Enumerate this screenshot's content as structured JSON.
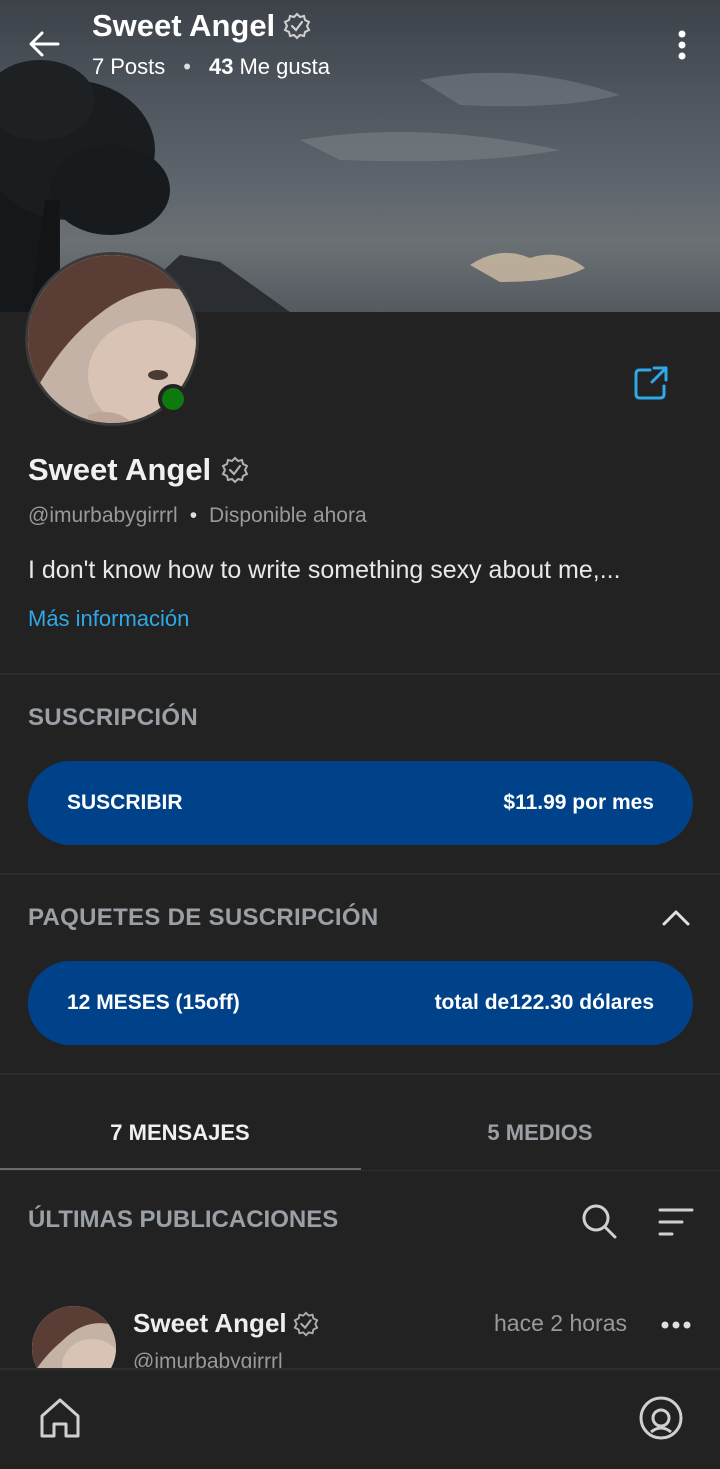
{
  "header": {
    "title": "Sweet Angel",
    "posts_count": "7",
    "posts_label": "Posts",
    "likes_count": "43",
    "likes_label": "Me gusta"
  },
  "profile": {
    "name": "Sweet Angel",
    "handle": "@imurbabygirrrl",
    "status": "Disponible ahora",
    "bio": "I don't know how to write something sexy about me,...",
    "more_info": "Más información",
    "online_color": "#0e7a0e"
  },
  "subscription": {
    "section_label": "SUSCRIPCIÓN",
    "button_label": "SUSCRIBIR",
    "price": "$11.99 por mes"
  },
  "bundles": {
    "section_label": "PAQUETES DE SUSCRIPCIÓN",
    "bundle_label": "12 MESES (15off)",
    "bundle_total": "total de122.30 dólares"
  },
  "tabs": [
    {
      "label": "7 MENSAJES",
      "active": true
    },
    {
      "label": "5 MEDIOS",
      "active": false
    }
  ],
  "latest": {
    "label": "ÚLTIMAS PUBLICACIONES"
  },
  "post": {
    "author": "Sweet Angel",
    "handle": "@imurbabygirrrl",
    "time": "hace 2 horas"
  },
  "colors": {
    "accent": "#2ea8e6",
    "button": "#00428a",
    "background": "#222222"
  },
  "icons": {
    "back": "arrow-left-icon",
    "menu": "kebab-menu-icon",
    "verified": "verified-badge-icon",
    "share": "share-icon",
    "collapse": "chevron-up-icon",
    "search": "search-icon",
    "sort": "sort-icon",
    "more": "more-horizontal-icon",
    "home": "home-icon",
    "profile": "profile-icon"
  }
}
